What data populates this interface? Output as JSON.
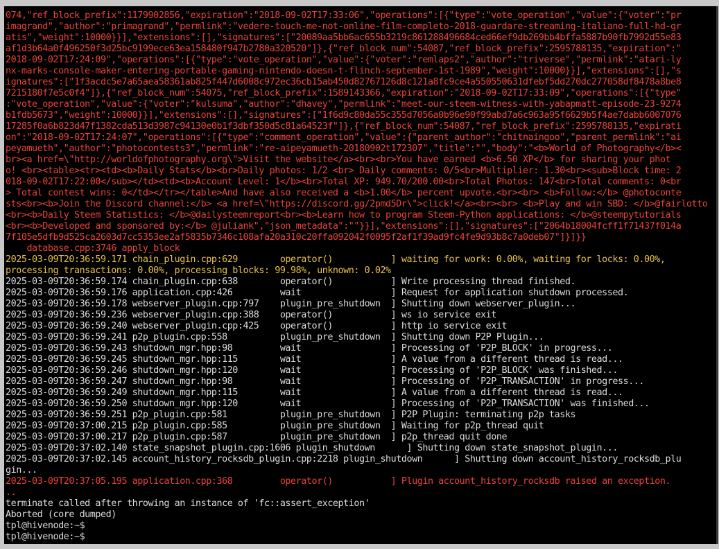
{
  "colors": {
    "background": "#000000",
    "error_text": "#e8423b",
    "warning_text": "#e8c14a",
    "normal_text": "#dcdcdc"
  },
  "terminal": {
    "lines": [
      {
        "text": "074,\"ref_block_prefix\":1179902856,\"expiration\":\"2018-09-02T17:33:06\",\"operations\":[{\"type\":\"vote_operation\",\"value\":{\"voter\":\"pr",
        "color": "red"
      },
      {
        "text": "imagrand\",\"author\":\"primagrand\",\"permlink\":\"vedere-touch-me-not-online-film-completo-2018-guardare-streaming-italiano-full-hd-gr",
        "color": "red"
      },
      {
        "text": "atis\",\"weight\":10000}}],\"extensions\":[],\"signatures\":[\"20089aa5bb6ac655b3219c861288496684ced66ef9db269bb4bffa5887b90fb7992d55e83",
        "color": "red"
      },
      {
        "text": "af1d3b64a0f496250f3d25bc9199ece63ea158480f947b2780a320520\"]},{\"ref_block_num\":54087,\"ref_block_prefix\":2595788135,\"expiration\":\"",
        "color": "red"
      },
      {
        "text": "2018-09-02T17:24:09\",\"operations\":[{\"type\":\"vote_operation\",\"value\":{\"voter\":\"remlaps2\",\"author\":\"triverse\",\"permlink\":\"atari-ly",
        "color": "red"
      },
      {
        "text": "nx-marks-console-maker-entering-portable-gaming-nintendo-doesn-t-flinch-september-1st-1989\",\"weight\":10000}}],\"extensions\":[],\"s",
        "color": "red"
      },
      {
        "text": "ignatures\":[\"1f3acdc5e7a65aea58361ab825f447d6008c972ec36cb15ab450d82767126d8c121a8fc9ce4a550550631dfebf5dd270dc277058df8478a8be8",
        "color": "red"
      },
      {
        "text": "7215180f7e5c0f4\"]},{\"ref_block_num\":54075,\"ref_block_prefix\":1589143366,\"expiration\":\"2018-09-02T17:33:09\",\"operations\":[{\"type\"",
        "color": "red"
      },
      {
        "text": ":\"vote_operation\",\"value\":{\"voter\":\"kulsuma\",\"author\":\"dhavey\",\"permlink\":\"meet-our-steem-witness-with-yabapmatt-episode-23-9274",
        "color": "red"
      },
      {
        "text": "b1fdb5673\",\"weight\":10000}}],\"extensions\":[],\"signatures\":[\"1f6d9c80da55c355d7056a0b96e90f99abd7a6c963a95f6629b5f4ae7dabb6007076",
        "color": "red"
      },
      {
        "text": "17285f0a6b823d47f1382cda513d3987c94130e0b1f3dbf350d5c81a64523f\"]},{\"ref_block_num\":54087,\"ref_block_prefix\":2595788135,\"expirati",
        "color": "red"
      },
      {
        "text": "on\":\"2018-09-02T17:24:07\",\"operations\":[{\"type\":\"comment_operation\",\"value\":{\"parent_author\":\"chitnaingoo\",\"parent_permlink\":\"ai",
        "color": "red"
      },
      {
        "text": "peyamueth\",\"author\":\"photocontests3\",\"permlink\":\"re-aipeyamueth-20180902t172307\",\"title\":\"\",\"body\":\"<b>World of Photography</b><",
        "color": "red"
      },
      {
        "text": "br><a href=\\\"http://worldofphotography.org\\\">Visit the website</a><br><br>You have earned <b>6.50 XP</b> for sharing your phot",
        "color": "red"
      },
      {
        "text": "o! <br><table><tr><td><b>Daily Stats</b><br>Daily photos: 1/2 <br> Daily comments: 0/5<br>Multiplier: 1.30<br><sub>Block time: 2",
        "color": "red"
      },
      {
        "text": "018-09-02T17:22:00</sub></td><td><b>Account Level: 1</b><br>Total XP: 949.70/200.00<br>Total Photos: 147<br>Total comments: 0<br",
        "color": "red"
      },
      {
        "text": "> Total contest wins: 0</td></tr></table>And have also received a <b>1.00</b> percent upvote.<br><br> <b>Follow:</b> @photoconte",
        "color": "red"
      },
      {
        "text": "sts<br><b>Join the Discord channel:</b> <a href=\\\"https://discord.gg/2pmd5Dr\\\">click!</a><br><br> <b>Play and win SBD: </b>@fairlotto",
        "color": "red"
      },
      {
        "text": "<br><b>Daily Steem Statistics: </b>@dailysteemreport<br><b>Learn how to program Steem-Python applications: </b>@steempytutorials",
        "color": "red"
      },
      {
        "text": "<br><b>Developed and sponsored by:</b> @juliank\",\"json_metadata\":\"\"}}],\"extensions\":[],\"signatures\":[\"2064b18004fcff1f71437f014a",
        "color": "red"
      },
      {
        "text": "7f105e5dfb9d525ca2603d7cc5353ee2af5835b7346c108afa20a310c20ffa092042f0095f2af1f39ad9fc4fe9d93b8c7a0deb07\"]}]}}",
        "color": "red"
      },
      {
        "text": "    database.cpp:3746 apply_block",
        "color": "red"
      },
      {
        "text": "2025-03-09T20:36:59.171 chain_plugin.cpp:629        operator()           ] waiting for work: 0.00%, waiting for locks: 0.00%,",
        "color": "yellow"
      },
      {
        "text": "processing transactions: 0.00%, processing blocks: 99.98%, unknown: 0.02%",
        "color": "yellow"
      },
      {
        "text": "2025-03-09T20:36:59.174 chain_plugin.cpp:638        operator()           ] Write processing thread finished.",
        "color": "white"
      },
      {
        "text": "2025-03-09T20:36:59.176 application.cpp:426         wait                 ] Request for application shutdown processed.",
        "color": "white"
      },
      {
        "text": "2025-03-09T20:36:59.178 webserver_plugin.cpp:797    plugin_pre_shutdown  ] Shutting down webserver_plugin...",
        "color": "white"
      },
      {
        "text": "2025-03-09T20:36:59.236 webserver_plugin.cpp:388    operator()           ] ws io service exit",
        "color": "white"
      },
      {
        "text": "2025-03-09T20:36:59.240 webserver_plugin.cpp:425    operator()           ] http io service exit",
        "color": "white"
      },
      {
        "text": "2025-03-09T20:36:59.241 p2p_plugin.cpp:558          plugin_pre_shutdown  ] Shutting down P2P Plugin...",
        "color": "white"
      },
      {
        "text": "2025-03-09T20:36:59.243 shutdown_mgr.hpp:98         wait                 ] Processing of 'P2P_BLOCK' in progress...",
        "color": "white"
      },
      {
        "text": "2025-03-09T20:36:59.245 shutdown_mgr.hpp:115        wait                 ] A value from a different thread is read...",
        "color": "white"
      },
      {
        "text": "2025-03-09T20:36:59.246 shutdown_mgr.hpp:120        wait                 ] Processing of 'P2P_BLOCK' was finished...",
        "color": "white"
      },
      {
        "text": "2025-03-09T20:36:59.247 shutdown_mgr.hpp:98         wait                 ] Processing of 'P2P_TRANSACTION' in progress...",
        "color": "white"
      },
      {
        "text": "2025-03-09T20:36:59.249 shutdown_mgr.hpp:115        wait                 ] A value from a different thread is read...",
        "color": "white"
      },
      {
        "text": "2025-03-09T20:36:59.250 shutdown_mgr.hpp:120        wait                 ] Processing of 'P2P_TRANSACTION' was finished...",
        "color": "white"
      },
      {
        "text": "2025-03-09T20:36:59.251 p2p_plugin.cpp:581          plugin_pre_shutdown  ] P2P Plugin: terminating p2p tasks",
        "color": "white"
      },
      {
        "text": "2025-03-09T20:37:00.215 p2p_plugin.cpp:585          plugin_pre_shutdown  ] Waiting for p2p_thread quit",
        "color": "white"
      },
      {
        "text": "2025-03-09T20:37:00.217 p2p_plugin.cpp:587          plugin_pre_shutdown  ] p2p_thread quit done",
        "color": "white"
      },
      {
        "text": "2025-03-09T20:37:02.140 state_snapshot_plugin.cpp:1606 plugin_shutdown      ] Shutting down state_snapshot_plugin...",
        "color": "white"
      },
      {
        "text": "2025-03-09T20:37:02.145 account_history_rocksdb_plugin.cpp:2218 plugin_shutdown      ] Shutting down account_history_rocksdb_plu",
        "color": "white"
      },
      {
        "text": "gin...",
        "color": "white"
      },
      {
        "text": "2025-03-09T20:37:05.195 application.cpp:368         operator()           ] Plugin account_history_rocksdb raised an exception.",
        "color": "red"
      },
      {
        "text": "..",
        "color": "red"
      },
      {
        "text": "terminate called after throwing an instance of 'fc::assert_exception'",
        "color": "white"
      },
      {
        "text": "Aborted (core dumped)",
        "color": "white"
      },
      {
        "text": "tpl@hivenode:~$",
        "color": "white"
      },
      {
        "text": "tpl@hivenode:~$",
        "color": "white"
      }
    ]
  }
}
